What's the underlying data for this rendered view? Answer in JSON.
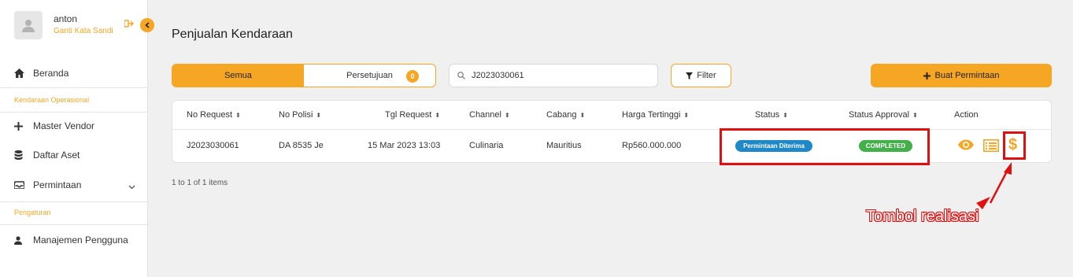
{
  "user": {
    "name": "anton",
    "change_password": "Ganti Kata Sandi"
  },
  "sidebar": {
    "items": [
      {
        "label": "Beranda",
        "icon": "home-icon"
      },
      {
        "section": "Kendaraan Operasional"
      },
      {
        "label": "Master Vendor",
        "icon": "plus-icon"
      },
      {
        "label": "Daftar Aset",
        "icon": "database-icon"
      },
      {
        "label": "Permintaan",
        "icon": "inbox-icon"
      },
      {
        "section": "Pengaturan"
      },
      {
        "label": "Manajemen Pengguna",
        "icon": "user-icon"
      }
    ]
  },
  "page": {
    "title": "Penjualan Kendaraan"
  },
  "tabs": {
    "all": "Semua",
    "approval": "Persetujuan",
    "approval_count": "0"
  },
  "search": {
    "value": "J2023030061"
  },
  "toolbar": {
    "filter_label": "Filter",
    "create_label": "Buat Permintaan"
  },
  "table": {
    "columns": [
      "No Request",
      "No Polisi",
      "Tgl Request",
      "Channel",
      "Cabang",
      "Harga Tertinggi",
      "Status",
      "Status Approval",
      "Action"
    ],
    "rows": [
      {
        "no_request": "J2023030061",
        "no_polisi": "DA 8535 Je",
        "tgl_request": "15 Mar 2023 13:03",
        "channel": "Culinaria",
        "cabang": "Mauritius",
        "harga": "Rp560.000.000",
        "status": "Permintaan Diterima",
        "status_approval": "COMPLETED"
      }
    ]
  },
  "pager": {
    "text": "1 to 1 of 1 items"
  },
  "annotation": {
    "callout": "Tombol realisasi"
  },
  "colors": {
    "accent": "#f5a623",
    "status_blue": "#1e88c8",
    "status_green": "#43b049",
    "annotation_red": "#e01010"
  }
}
